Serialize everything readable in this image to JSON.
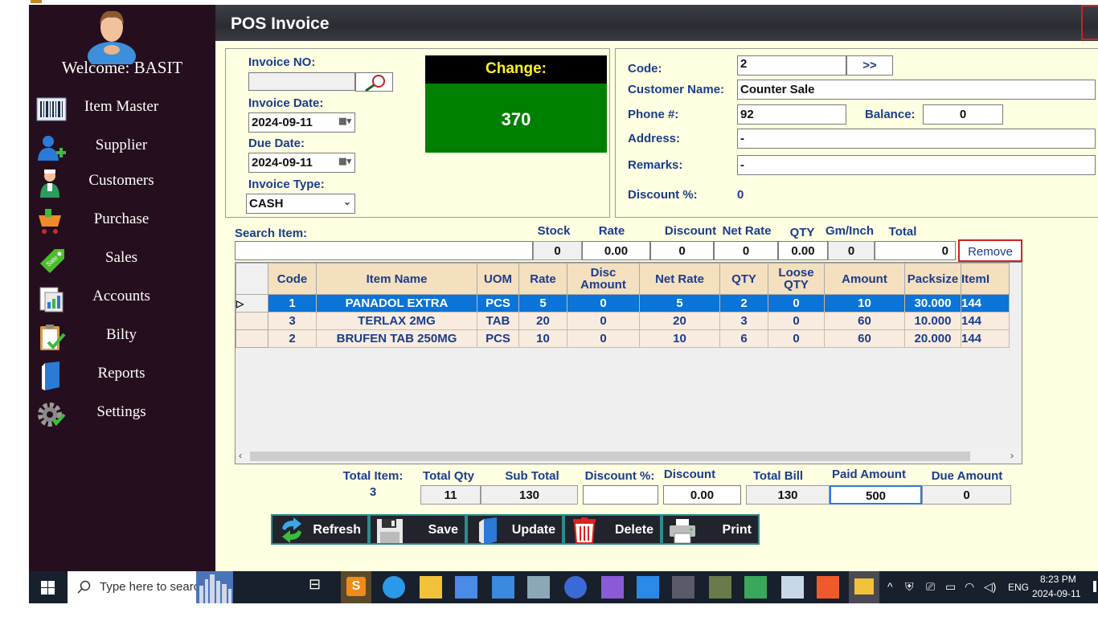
{
  "sidebar": {
    "welcome": "Welcome: BASIT",
    "items": [
      {
        "label": "Item Master",
        "icon": "barcode-icon"
      },
      {
        "label": "Supplier",
        "icon": "add-user-icon"
      },
      {
        "label": "Customers",
        "icon": "doctor-icon"
      },
      {
        "label": "Purchase",
        "icon": "cart-icon"
      },
      {
        "label": "Sales",
        "icon": "sale-tag-icon"
      },
      {
        "label": "Accounts",
        "icon": "accounts-icon"
      },
      {
        "label": "Bilty",
        "icon": "clipboard-check-icon"
      },
      {
        "label": "Reports",
        "icon": "book-icon"
      },
      {
        "label": "Settings",
        "icon": "gear-icon"
      }
    ]
  },
  "header": {
    "title": "POS Invoice"
  },
  "invoice": {
    "no_label": "Invoice NO:",
    "no_value": "",
    "date_label": "Invoice Date:",
    "date_value": "2024-09-11",
    "due_label": "Due Date:",
    "due_value": "2024-09-11",
    "type_label": "Invoice Type:",
    "type_value": "CASH"
  },
  "change": {
    "label": "Change:",
    "value": "370"
  },
  "customer": {
    "code_label": "Code:",
    "code_value": "2",
    "lookup_label": ">>",
    "name_label": "Customer Name:",
    "name_value": "Counter Sale",
    "phone_label": "Phone #:",
    "phone_value": "92",
    "balance_label": "Balance:",
    "balance_value": "0",
    "address_label": "Address:",
    "address_value": "-",
    "remarks_label": "Remarks:",
    "remarks_value": "-",
    "discount_label": "Discount %:",
    "discount_value": "0"
  },
  "search": {
    "label": "Search Item:",
    "value": "",
    "stock_label": "Stock",
    "stock_value": "0",
    "rate_label": "Rate",
    "rate_value": "0.00",
    "discount_label": "Discount",
    "discount_value": "0",
    "netrate_label": "Net Rate",
    "netrate_value": "0",
    "qty_label": "QTY",
    "qty_value": "0.00",
    "gminch_label": "Gm/Inch",
    "gminch_value": "0",
    "total_label": "Total",
    "total_value": "0",
    "remove_label": "Remove"
  },
  "grid": {
    "columns": [
      "Code",
      "Item Name",
      "UOM",
      "Rate",
      "Disc Amount",
      "Net Rate",
      "QTY",
      "Loose QTY",
      "Amount",
      "Packsize",
      "ItemI"
    ],
    "rows": [
      [
        "1",
        "PANADOL EXTRA",
        "PCS",
        "5",
        "0",
        "5",
        "2",
        "0",
        "10",
        "30.000",
        "144"
      ],
      [
        "3",
        "TERLAX 2MG",
        "TAB",
        "20",
        "0",
        "20",
        "3",
        "0",
        "60",
        "10.000",
        "144"
      ],
      [
        "2",
        "BRUFEN TAB 250MG",
        "PCS",
        "10",
        "0",
        "10",
        "6",
        "0",
        "60",
        "20.000",
        "144"
      ]
    ],
    "selected_row": 0
  },
  "totals": {
    "items_label": "Total Item:",
    "items_value": "3",
    "qty_label": "Total Qty",
    "qty_value": "11",
    "subtotal_label": "Sub Total",
    "subtotal_value": "130",
    "discpct_label": "Discount %:",
    "discpct_value": "",
    "discount_label": "Discount",
    "discount_value": "0.00",
    "bill_label": "Total Bill",
    "bill_value": "130",
    "paid_label": "Paid Amount",
    "paid_value": "500",
    "due_label": "Due Amount",
    "due_value": "0"
  },
  "buttons": {
    "refresh": "Refresh",
    "save": "Save",
    "update": "Update",
    "delete": "Delete",
    "print": "Print"
  },
  "taskbar": {
    "search_placeholder": "Type here to search",
    "time": "8:23 PM",
    "date": "2024-09-11",
    "lang": "ENG"
  },
  "colors": {
    "sidebar_bg": "#250f1e",
    "form_bg": "#ffffe2",
    "change_bg": "#008000",
    "selected_row": "#0a74d8",
    "grid_header": "#f4e0bf",
    "label_blue": "#1a3c8c"
  }
}
